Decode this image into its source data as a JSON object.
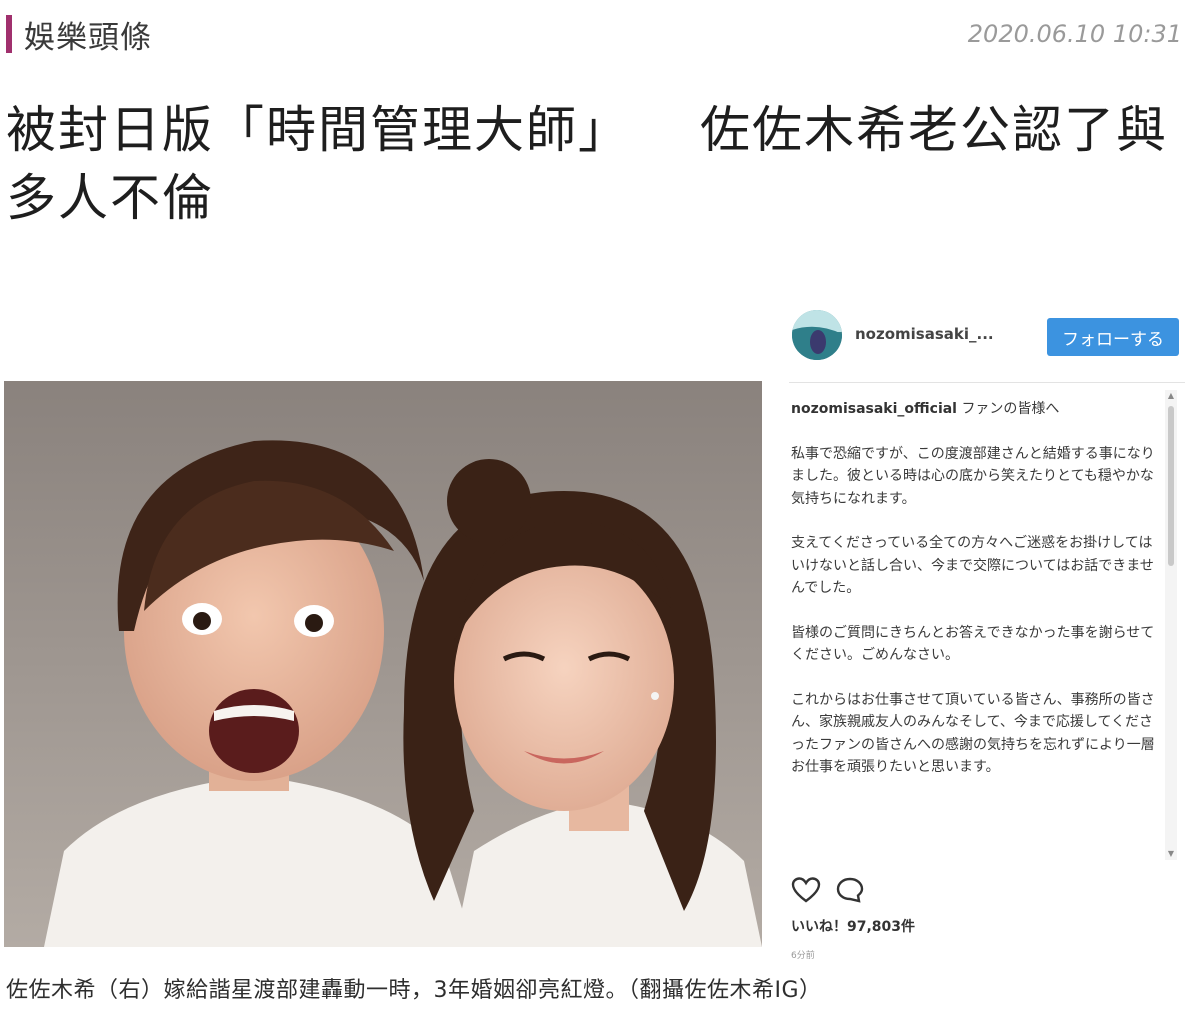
{
  "header": {
    "category": "娛樂頭條",
    "timestamp": "2020.06.10 10:31"
  },
  "article": {
    "headline_part1": "被封日版「時間管理大師」",
    "headline_part2": "佐佐木希老公認了與多人不倫"
  },
  "instagram": {
    "username": "nozomisasaki_...",
    "follow_label": "フォローする",
    "caption_user": "nozomisasaki_official",
    "caption_first_line": "ファンの皆様へ",
    "caption_paragraphs": [
      "私事で恐縮ですが、この度渡部建さんと結婚する事になりました。彼といる時は心の底から笑えたりとても穏やかな気持ちになれます。",
      "支えてくださっている全ての方々へご迷惑をお掛けしてはいけないと話し合い、今まで交際についてはお話できませんでした。",
      "皆様のご質問にきちんとお答えできなかった事を謝らせてください。ごめんなさい。",
      "これからはお仕事させて頂いている皆さん、事務所の皆さん、家族親戚友人のみんなそして、今まで応援してくださったファンの皆さんへの感謝の気持ちを忘れずにより一層お仕事を頑張りたいと思います。"
    ],
    "likes": "いいね！97,803件",
    "time_ago": "6分前",
    "icons": [
      "heart-icon",
      "comment-icon"
    ]
  },
  "figure": {
    "caption": "佐佐木希（右）嫁給諧星渡部建轟動一時，3年婚姻卻亮紅燈。（翻攝佐佐木希IG）"
  },
  "colors": {
    "accent": "#a0306d",
    "follow_button": "#3c93e0"
  }
}
